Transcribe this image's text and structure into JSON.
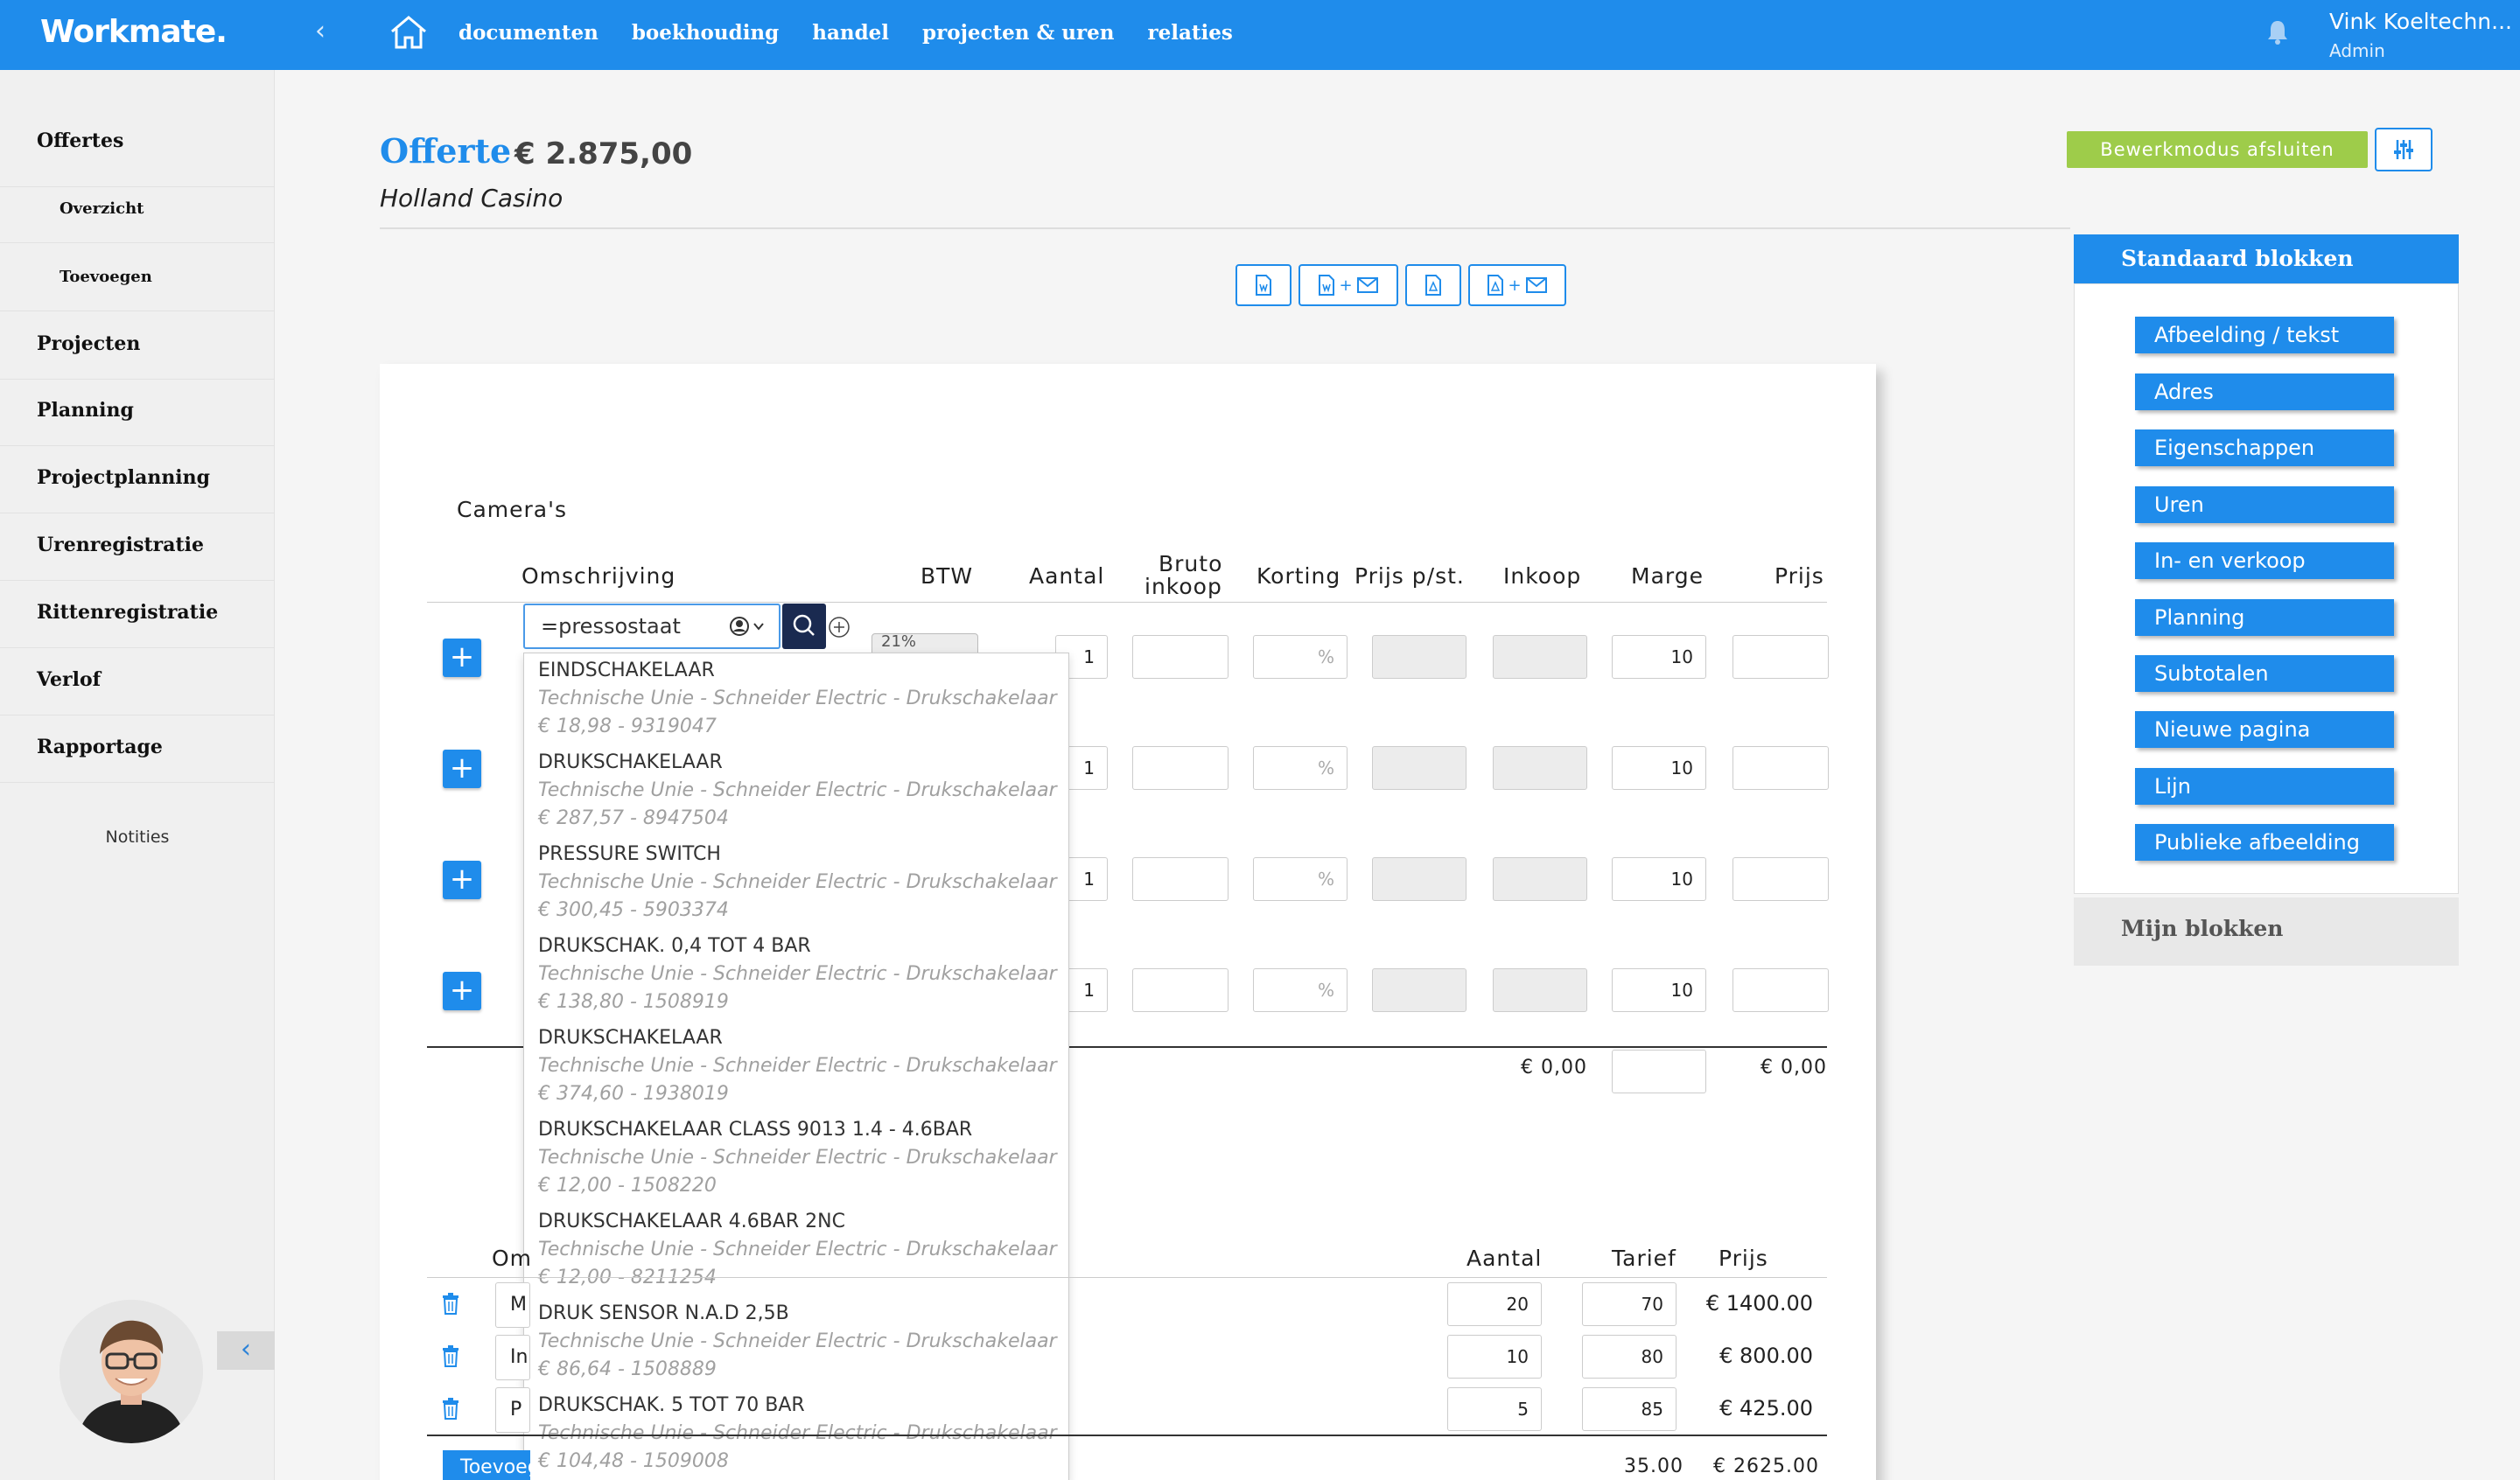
{
  "app": {
    "logo": "Workmate.",
    "nav": [
      "documenten",
      "boekhouding",
      "handel",
      "projecten & uren",
      "relaties"
    ],
    "user_name": "Vink Koeltechn...",
    "user_role": "Admin",
    "accent": "#1f8ceb"
  },
  "sidebar": {
    "items": [
      "Offertes",
      "Overzicht",
      "Toevoegen",
      "Projecten",
      "Planning",
      "Projectplanning",
      "Urenregistratie",
      "Rittenregistratie",
      "Verlof",
      "Rapportage"
    ],
    "notities": "Notities"
  },
  "header": {
    "title": "Offerte",
    "amount": "€ 2.875,00",
    "client": "Holland Casino",
    "close_edit": "Bewerkmodus afsluiten"
  },
  "block": {
    "title": "Camera's",
    "columns": {
      "omschrijving": "Omschrijving",
      "btw": "BTW",
      "aantal": "Aantal",
      "bruto1": "Bruto",
      "bruto2": "inkoop",
      "korting": "Korting",
      "prijs_st": "Prijs p/st.",
      "inkoop": "Inkoop",
      "marge": "Marge",
      "prijs": "Prijs"
    },
    "rows": [
      {
        "aantal": "1",
        "korting": "%",
        "marge": "10"
      },
      {
        "aantal": "1",
        "korting": "%",
        "marge": "10"
      },
      {
        "aantal": "1",
        "korting": "%",
        "marge": "10"
      },
      {
        "aantal": "1",
        "korting": "%",
        "marge": "10"
      }
    ],
    "search_value": "=pressostaat",
    "btw_partial": "21%",
    "total_left": "€ 0,00",
    "total_right": "€ 0,00"
  },
  "dropdown": [
    {
      "name": "EINDSCHAKELAAR",
      "desc": "Technische Unie - Schneider Electric - Drukschakelaar",
      "price": "€ 18,98 - 9319047"
    },
    {
      "name": "DRUKSCHAKELAAR",
      "desc": "Technische Unie - Schneider Electric - Drukschakelaar",
      "price": "€ 287,57 - 8947504"
    },
    {
      "name": "PRESSURE SWITCH",
      "desc": "Technische Unie - Schneider Electric - Drukschakelaar",
      "price": "€ 300,45 - 5903374"
    },
    {
      "name": "DRUKSCHAK. 0,4 TOT 4 BAR",
      "desc": "Technische Unie - Schneider Electric - Drukschakelaar",
      "price": "€ 138,80 - 1508919"
    },
    {
      "name": "DRUKSCHAKELAAR",
      "desc": "Technische Unie - Schneider Electric - Drukschakelaar",
      "price": "€ 374,60 - 1938019"
    },
    {
      "name": "DRUKSCHAKELAAR CLASS 9013 1.4 - 4.6BAR",
      "desc": "Technische Unie - Schneider Electric - Drukschakelaar",
      "price": "€ 12,00 - 1508220"
    },
    {
      "name": "DRUKSCHAKELAAR 4.6BAR 2NC",
      "desc": "Technische Unie - Schneider Electric - Drukschakelaar",
      "price": "€ 12,00 - 8211254"
    },
    {
      "name": "DRUK SENSOR N.A.D 2,5B",
      "desc": "Technische Unie - Schneider Electric - Drukschakelaar",
      "price": "€ 86,64 - 1508889"
    },
    {
      "name": "DRUKSCHAK. 5 TOT 70 BAR",
      "desc": "Technische Unie - Schneider Electric - Drukschakelaar",
      "price": "€ 104,48 - 1509008"
    }
  ],
  "labor": {
    "columns": {
      "omschrijving": "Om",
      "aantal": "Aantal",
      "tarief": "Tarief",
      "prijs": "Prijs"
    },
    "rows": [
      {
        "desc": "M",
        "aantal": "20",
        "tarief": "70",
        "prijs": "€ 1400.00"
      },
      {
        "desc": "In",
        "aantal": "10",
        "tarief": "80",
        "prijs": "€ 800.00"
      },
      {
        "desc": "P",
        "aantal": "5",
        "tarief": "85",
        "prijs": "€ 425.00"
      }
    ],
    "total_aantal": "35.00",
    "total_prijs": "€ 2625.00",
    "add_button": "Toevoegen"
  },
  "blocks_panel": {
    "title": "Standaard blokken",
    "items": [
      "Afbeelding / tekst",
      "Adres",
      "Eigenschappen",
      "Uren",
      "In- en verkoop",
      "Planning",
      "Subtotalen",
      "Nieuwe pagina",
      "Lijn",
      "Publieke afbeelding"
    ],
    "my_blocks": "Mijn blokken"
  }
}
